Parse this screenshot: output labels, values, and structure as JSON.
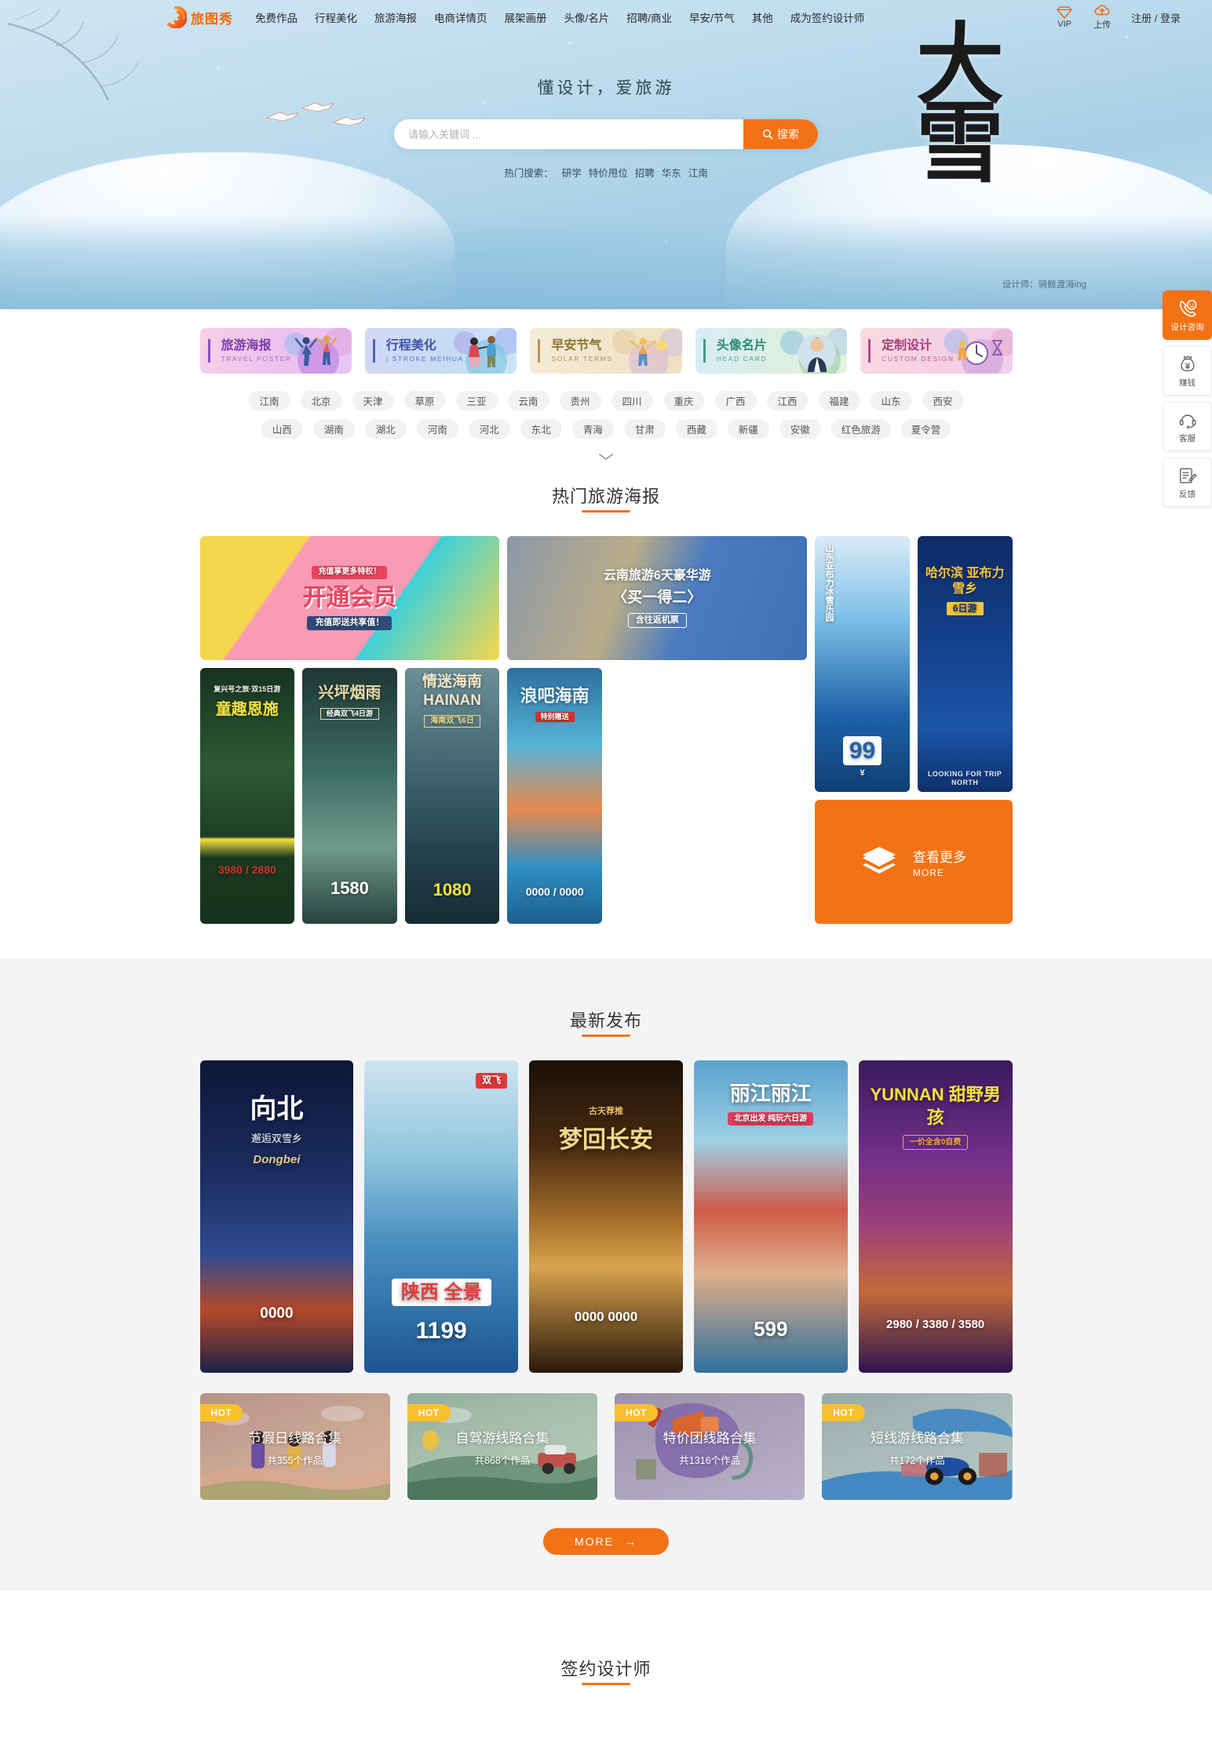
{
  "site": {
    "logo_text": "旅图秀",
    "logo_icon": "spiral-logo-icon"
  },
  "nav": {
    "menu": [
      {
        "label": "免费作品"
      },
      {
        "label": "行程美化"
      },
      {
        "label": "旅游海报"
      },
      {
        "label": "电商详情页"
      },
      {
        "label": "展架画册"
      },
      {
        "label": "头像/名片"
      },
      {
        "label": "招聘/商业"
      },
      {
        "label": "早安/节气"
      },
      {
        "label": "其他"
      },
      {
        "label": "成为签约设计师"
      }
    ],
    "vip_label": "VIP",
    "upload_label": "上传",
    "auth_label": "注册 / 登录"
  },
  "hero": {
    "slogan": "懂设计，爱旅游",
    "big_word_1": "大",
    "big_word_2": "雪",
    "designer_credit": "设计师：骑鲸渡海ing"
  },
  "search": {
    "placeholder": "请输入关键词 ...",
    "value": "",
    "button_label": "搜索",
    "hot_label": "热门搜索：",
    "hot_items": [
      "研学",
      "特价甩位",
      "招聘",
      "华东",
      "江南"
    ]
  },
  "side_dock": [
    {
      "label": "设计咨询",
      "icon": "phone-chat-icon",
      "primary": true
    },
    {
      "label": "赚钱",
      "icon": "money-bag-icon",
      "primary": false
    },
    {
      "label": "客服",
      "icon": "headset-icon",
      "primary": false
    },
    {
      "label": "反馈",
      "icon": "feedback-note-icon",
      "primary": false
    }
  ],
  "categories": [
    {
      "cn": "旅游海报",
      "en": "TRAVEL POSTER",
      "bg1": "#f7c7e4",
      "bg2": "#e8b6f0",
      "accent": "#8a4fbf",
      "text": "#7a3fa8",
      "fig": "two-people-cheering"
    },
    {
      "cn": "行程美化",
      "en": "| STROKE MEIHUA",
      "bg1": "#cdd4f5",
      "bg2": "#bfd9f2",
      "accent": "#4f63bf",
      "text": "#3f53ac",
      "fig": "couple-walking"
    },
    {
      "cn": "早安节气",
      "en": "SOLAR TERMS",
      "bg1": "#f2e9d3",
      "bg2": "#efe2c4",
      "accent": "#b09556",
      "text": "#8d7434",
      "fig": "person-sun"
    },
    {
      "cn": "头像名片",
      "en": "HEAD CARD",
      "bg1": "#cfeaf3",
      "bg2": "#d7e9d6",
      "accent": "#3f9e8a",
      "text": "#2f8a76",
      "fig": "businessman-avatar"
    },
    {
      "cn": "定制设计",
      "en": "CUSTOM DESIGN",
      "bg1": "#f8d5dc",
      "bg2": "#f0cfe6",
      "accent": "#b24c8c",
      "text": "#a33f7e",
      "fig": "clock-hourglass"
    }
  ],
  "tags": {
    "row1": [
      "江南",
      "北京",
      "天津",
      "草原",
      "三亚",
      "云南",
      "贵州",
      "四川",
      "重庆",
      "广西",
      "江西",
      "福建",
      "山东",
      "西安"
    ],
    "row2": [
      "山西",
      "湖南",
      "湖北",
      "河南",
      "河北",
      "东北",
      "青海",
      "甘肃",
      "西藏",
      "新疆",
      "安徽",
      "红色旅游",
      "夏令营"
    ],
    "expand_icon": "chevron-down-icon"
  },
  "sections": {
    "hot_posters_title": "热门旅游海报",
    "latest_title": "最新发布",
    "designers_title": "签约设计师"
  },
  "hot_posters": [
    {
      "title": "开通会员",
      "sub": "充值即送共享值！",
      "tag": "充值享更多特权！",
      "c1": "#f9d85a",
      "c2": "#f58fb0",
      "c3": "#3ecfd8"
    },
    {
      "title": "云南旅游6天豪华游",
      "sub": "〈买一得二〉",
      "tag": "含往返机票",
      "c1": "#9aa6b5",
      "c2": "#3f6fb5",
      "c3": "#d9c79a"
    },
    {
      "title": "山东亚布力冰雪乐园",
      "sub": "99",
      "tag": "¥",
      "c1": "#1b4f8f",
      "c2": "#4ea3dd",
      "c3": "#ffffff"
    },
    {
      "title": "哈尔滨 亚布力 雪乡",
      "sub": "6日游",
      "tag": "LOOKING FOR TRIP NORTH",
      "c1": "#0d2a66",
      "c2": "#1b4fa8",
      "c3": "#f5c542"
    },
    {
      "title": "童趣恩施",
      "sub": "3980 / 2880",
      "tag": "复兴号之旅·双15日游",
      "c1": "#1d3a22",
      "c2": "#2f5c33",
      "c3": "#f7e23d"
    },
    {
      "title": "兴坪烟雨",
      "sub": "1580",
      "tag": "经典双飞4日游",
      "c1": "#24403e",
      "c2": "#3d6b63",
      "c3": "#e9d9a8"
    },
    {
      "title": "情迷海南 HAINAN",
      "sub": "1080",
      "tag": "海南双飞6日",
      "c1": "#2d4f5c",
      "c2": "#5d8c96",
      "c3": "#f2d98a"
    },
    {
      "title": "浪吧海南",
      "sub": "0000 / 0000",
      "tag": "特别赠送",
      "c1": "#1a6fa8",
      "c2": "#3fa8d8",
      "c3": "#f06a3f"
    }
  ],
  "more_card": {
    "cn": "查看更多",
    "en": "MORE",
    "icon": "layers-stack-icon"
  },
  "latest_posters": [
    {
      "title": "向北",
      "sub": "邂逅双雪乡",
      "note": "Dongbei",
      "price": "0000",
      "c1": "#0f1a3d",
      "c2": "#2a3f7a",
      "c3": "#e8663f"
    },
    {
      "title": "陕西 全景",
      "sub": "1199",
      "note": "双飞",
      "price": "1199",
      "c1": "#2f6fa8",
      "c2": "#8fc4dd",
      "c3": "#e03c3c"
    },
    {
      "title": "梦回长安",
      "sub": "0000  0000",
      "note": "古天荐推",
      "price": "0000",
      "c1": "#2b1a0d",
      "c2": "#8a5a2b",
      "c3": "#f0c36a"
    },
    {
      "title": "丽江丽江",
      "sub": "599",
      "note": "北京出发 纯玩六日游",
      "price": "599",
      "c1": "#2f6f9e",
      "c2": "#6fb0d8",
      "c3": "#e03c5c"
    },
    {
      "title": "YUNNAN 甜野男孩",
      "sub": "2980 / 3380 / 3580",
      "note": "一价全含0自费",
      "price": "2980",
      "c1": "#3a1a5c",
      "c2": "#7a2f8a",
      "c3": "#f0a63c"
    }
  ],
  "collections": [
    {
      "title": "节假日线路合集",
      "count": "共355个作品",
      "badge": "HOT",
      "c1": "#b2897a",
      "c2": "#c9a08e"
    },
    {
      "title": "自驾游线路合集",
      "count": "共868个作品",
      "badge": "HOT",
      "c1": "#8fab9c",
      "c2": "#a6bfae"
    },
    {
      "title": "特价团线路合集",
      "count": "共1316个作品",
      "badge": "HOT",
      "c1": "#9a93a8",
      "c2": "#b0a8bd"
    },
    {
      "title": "短线游线路合集",
      "count": "共172个作品",
      "badge": "HOT",
      "c1": "#96a8a5",
      "c2": "#aabcbb"
    }
  ],
  "more_button": {
    "label": "MORE",
    "arrow": "→"
  },
  "colors": {
    "brand_orange": "#f47216",
    "badge_yellow": "#f8c12c",
    "page_gray": "#f4f4f4"
  }
}
